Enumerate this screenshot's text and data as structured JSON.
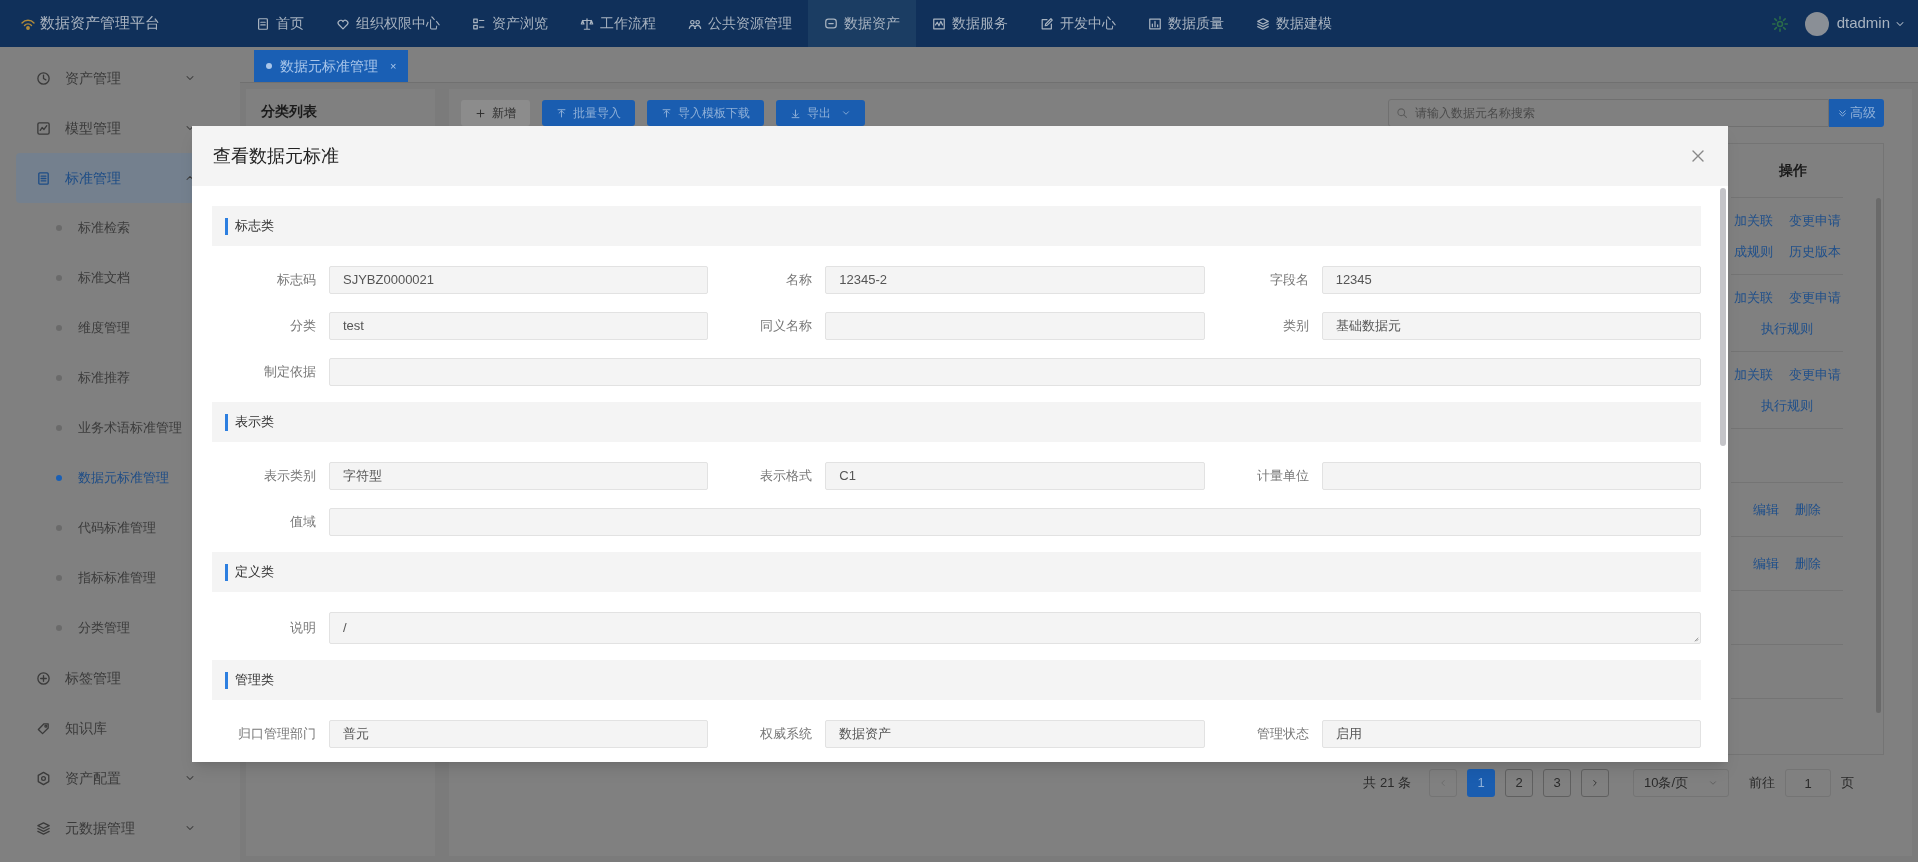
{
  "header": {
    "brand": "数据资产管理平台",
    "user": "dtadmin",
    "nav": [
      {
        "label": "首页",
        "selected": false
      },
      {
        "label": "组织权限中心",
        "selected": false
      },
      {
        "label": "资产浏览",
        "selected": false
      },
      {
        "label": "工作流程",
        "selected": false
      },
      {
        "label": "公共资源管理",
        "selected": false
      },
      {
        "label": "数据资产",
        "selected": true
      },
      {
        "label": "数据服务",
        "selected": false
      },
      {
        "label": "开发中心",
        "selected": false
      },
      {
        "label": "数据质量",
        "selected": false
      },
      {
        "label": "数据建模",
        "selected": false
      }
    ]
  },
  "sidebar": {
    "items": [
      {
        "label": "资产管理",
        "kind": "submenu",
        "expanded": false,
        "selected": false
      },
      {
        "label": "模型管理",
        "kind": "submenu",
        "expanded": false,
        "selected": false
      },
      {
        "label": "标准管理",
        "kind": "submenu",
        "expanded": true,
        "selected": true,
        "children": [
          {
            "label": "标准检索",
            "selected": false
          },
          {
            "label": "标准文档",
            "selected": false
          },
          {
            "label": "维度管理",
            "selected": false
          },
          {
            "label": "标准推荐",
            "selected": false
          },
          {
            "label": "业务术语标准管理",
            "selected": false
          },
          {
            "label": "数据元标准管理",
            "selected": true
          },
          {
            "label": "代码标准管理",
            "selected": false
          },
          {
            "label": "指标标准管理",
            "selected": false
          },
          {
            "label": "分类管理",
            "selected": false
          }
        ]
      },
      {
        "label": "标签管理",
        "kind": "item",
        "selected": false
      },
      {
        "label": "知识库",
        "kind": "item",
        "selected": false
      },
      {
        "label": "资产配置",
        "kind": "submenu",
        "expanded": false,
        "selected": false
      },
      {
        "label": "元数据管理",
        "kind": "submenu",
        "expanded": false,
        "selected": false
      }
    ]
  },
  "tabs": [
    {
      "label": "数据元标准管理",
      "selected": true,
      "close": "×"
    }
  ],
  "category_panel": {
    "title": "分类列表"
  },
  "toolbar": {
    "buttons": [
      {
        "label": "新增",
        "disabled": true
      },
      {
        "label": "批量导入",
        "disabled": false
      },
      {
        "label": "导入模板下载",
        "disabled": false
      },
      {
        "label": "导出",
        "disabled": false,
        "dropdown": true
      }
    ],
    "search": {
      "placeholder": "请输入数据元名称搜索"
    },
    "advanced": "高级"
  },
  "table": {
    "columns": [
      "操作"
    ],
    "rows": [
      {
        "lines": [
          [
            "加关联",
            "变更申请"
          ],
          [
            "成规则",
            "历史版本"
          ]
        ]
      },
      {
        "lines": [
          [
            "加关联",
            "变更申请"
          ],
          [
            "执行规则"
          ]
        ]
      },
      {
        "lines": [
          [
            "加关联",
            "变更申请"
          ],
          [
            "执行规则"
          ]
        ]
      },
      {},
      {
        "lines": [
          [
            "编辑",
            "删除"
          ]
        ]
      },
      {
        "lines": [
          [
            "编辑",
            "删除"
          ]
        ]
      },
      {},
      {}
    ]
  },
  "pagination": {
    "total": "共 21 条",
    "pages": [
      {
        "label": "1",
        "selected": true
      },
      {
        "label": "2",
        "selected": false
      },
      {
        "label": "3",
        "selected": false
      }
    ],
    "page_size": "10条/页",
    "goto_label": "前往",
    "goto_value": "1",
    "goto_suffix": "页"
  },
  "dialog": {
    "title": "查看数据元标准",
    "sections": [
      {
        "title": "标志类",
        "fields": [
          {
            "label": "标志码",
            "kind": "input",
            "value": "SJYBZ0000021"
          },
          {
            "label": "名称",
            "kind": "input",
            "value": "12345-2"
          },
          {
            "label": "字段名",
            "kind": "input",
            "value": "12345"
          },
          {
            "label": "分类",
            "kind": "input",
            "value": "test"
          },
          {
            "label": "同义名称",
            "kind": "input"
          },
          {
            "label": "类别",
            "kind": "input",
            "value": "基础数据元"
          },
          {
            "label": "制定依据",
            "kind": "wide"
          }
        ]
      },
      {
        "title": "表示类",
        "fields": [
          {
            "label": "表示类别",
            "kind": "input",
            "value": "字符型"
          },
          {
            "label": "表示格式",
            "kind": "input",
            "value": "C1"
          },
          {
            "label": "计量单位",
            "kind": "input"
          },
          {
            "label": "值域",
            "kind": "wide"
          }
        ]
      },
      {
        "title": "定义类",
        "fields": [
          {
            "label": "说明",
            "kind": "textarea",
            "value": "/"
          }
        ]
      },
      {
        "title": "管理类",
        "fields": [
          {
            "label": "归口管理部门",
            "kind": "input",
            "value": "普元"
          },
          {
            "label": "权威系统",
            "kind": "input",
            "value": "数据资产"
          },
          {
            "label": "管理状态",
            "kind": "input",
            "value": "启用"
          }
        ]
      }
    ]
  }
}
